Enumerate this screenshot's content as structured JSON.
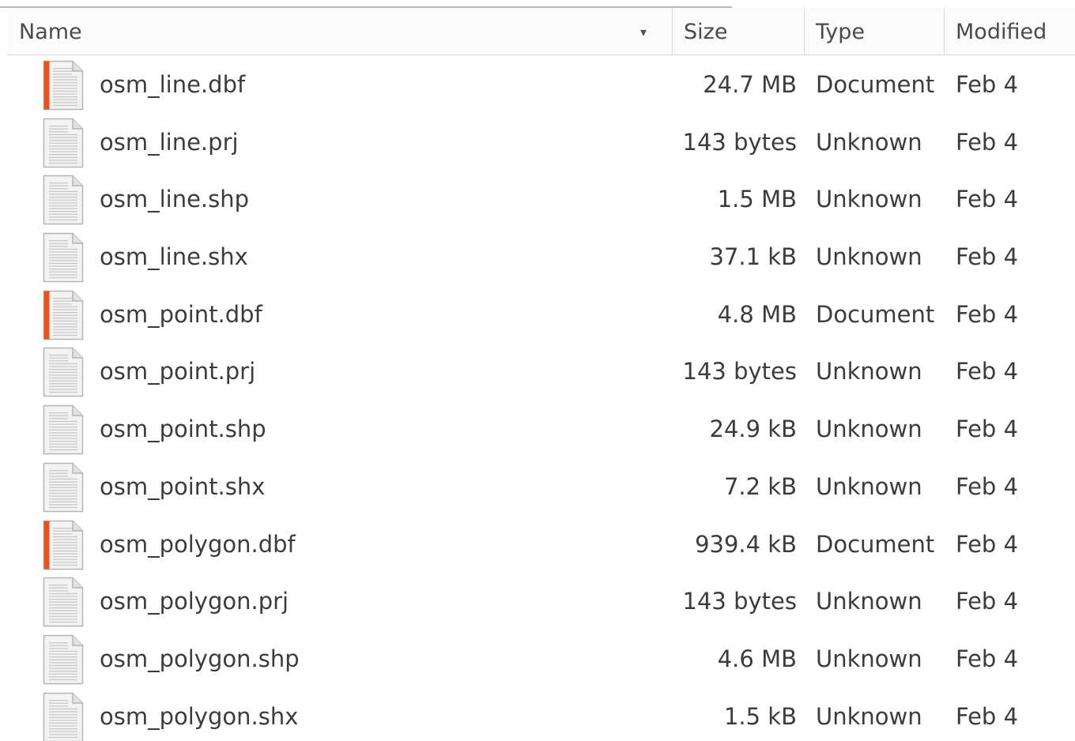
{
  "header": {
    "columns": {
      "name": "Name",
      "size": "Size",
      "type": "Type",
      "modified": "Modified"
    },
    "sort_indicator": "▾"
  },
  "colors": {
    "document_icon_accent": "#e8541c",
    "text": "#3c3c3c",
    "header_bg": "#fbfbfb"
  },
  "files": [
    {
      "name": "osm_line.dbf",
      "size": "24.7 MB",
      "type": "Document",
      "modified": "Feb 4",
      "icon": "spreadsheet-document-icon"
    },
    {
      "name": "osm_line.prj",
      "size": "143 bytes",
      "type": "Unknown",
      "modified": "Feb 4",
      "icon": "text-file-icon"
    },
    {
      "name": "osm_line.shp",
      "size": "1.5 MB",
      "type": "Unknown",
      "modified": "Feb 4",
      "icon": "text-file-icon"
    },
    {
      "name": "osm_line.shx",
      "size": "37.1 kB",
      "type": "Unknown",
      "modified": "Feb 4",
      "icon": "text-file-icon"
    },
    {
      "name": "osm_point.dbf",
      "size": "4.8 MB",
      "type": "Document",
      "modified": "Feb 4",
      "icon": "spreadsheet-document-icon"
    },
    {
      "name": "osm_point.prj",
      "size": "143 bytes",
      "type": "Unknown",
      "modified": "Feb 4",
      "icon": "text-file-icon"
    },
    {
      "name": "osm_point.shp",
      "size": "24.9 kB",
      "type": "Unknown",
      "modified": "Feb 4",
      "icon": "text-file-icon"
    },
    {
      "name": "osm_point.shx",
      "size": "7.2 kB",
      "type": "Unknown",
      "modified": "Feb 4",
      "icon": "text-file-icon"
    },
    {
      "name": "osm_polygon.dbf",
      "size": "939.4 kB",
      "type": "Document",
      "modified": "Feb 4",
      "icon": "spreadsheet-document-icon"
    },
    {
      "name": "osm_polygon.prj",
      "size": "143 bytes",
      "type": "Unknown",
      "modified": "Feb 4",
      "icon": "text-file-icon"
    },
    {
      "name": "osm_polygon.shp",
      "size": "4.6 MB",
      "type": "Unknown",
      "modified": "Feb 4",
      "icon": "text-file-icon"
    },
    {
      "name": "osm_polygon.shx",
      "size": "1.5 kB",
      "type": "Unknown",
      "modified": "Feb 4",
      "icon": "text-file-icon"
    }
  ]
}
